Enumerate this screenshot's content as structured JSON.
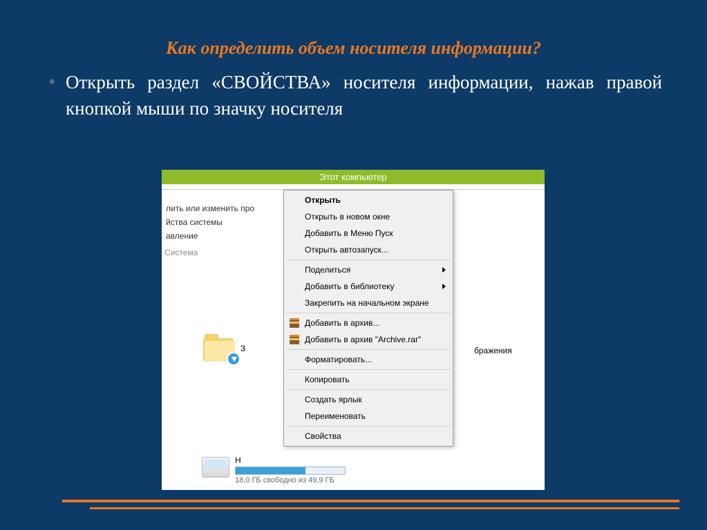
{
  "slide": {
    "title": "Как определить объем носителя информации?",
    "bullet": "Открыть раздел «СВОЙСТВА» носителя информации, нажав правой кнопкой мыши по значку носителя"
  },
  "window": {
    "title": "Этот компьютер",
    "sidebar": {
      "item1": "лить или изменить про",
      "item2": "йства системы",
      "item3": "авление",
      "group": "Система"
    },
    "folder_hint": "З",
    "right_label": "бражения",
    "drive": {
      "name": "Н",
      "free_text": "18,0 ГБ свободно из 49,9 ГБ"
    }
  },
  "context_menu": {
    "open": "Открыть",
    "open_new": "Открыть в новом окне",
    "add_start": "Добавить в Меню Пуск",
    "autorun": "Открыть автозапуск...",
    "share": "Поделиться",
    "add_lib": "Добавить в библиотеку",
    "pin": "Закрепить на начальном экране",
    "add_archive": "Добавить в архив...",
    "add_archive_rar": "Добавить в архив \"Archive.rar\"",
    "format": "Форматировать...",
    "copy": "Копировать",
    "shortcut": "Создать ярлык",
    "rename": "Переименовать",
    "properties": "Свойства"
  }
}
